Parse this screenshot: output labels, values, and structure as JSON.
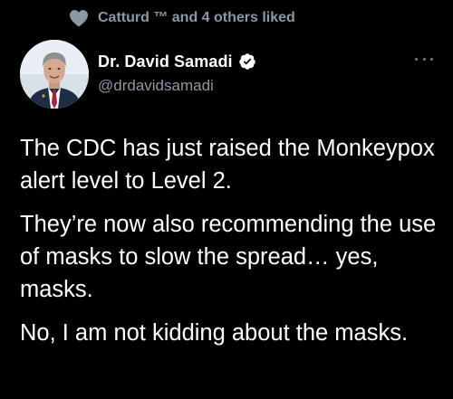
{
  "social_context": {
    "icon": "heart-icon",
    "text": "Catturd ™ and 4 others liked"
  },
  "author": {
    "name": "Dr. David Samadi",
    "handle": "@drdavidsamadi",
    "verified": true,
    "verified_color": "#ffffff"
  },
  "tweet": {
    "paragraphs": [
      "The CDC has just raised the Monkeypox alert level to Level 2.",
      "They’re now also recommending the use of masks to slow the spread… yes, masks.",
      "No, I am not kidding about the masks."
    ]
  },
  "colors": {
    "background": "#000000",
    "primary_text": "#ffffff",
    "secondary_text": "#8b98a5"
  }
}
